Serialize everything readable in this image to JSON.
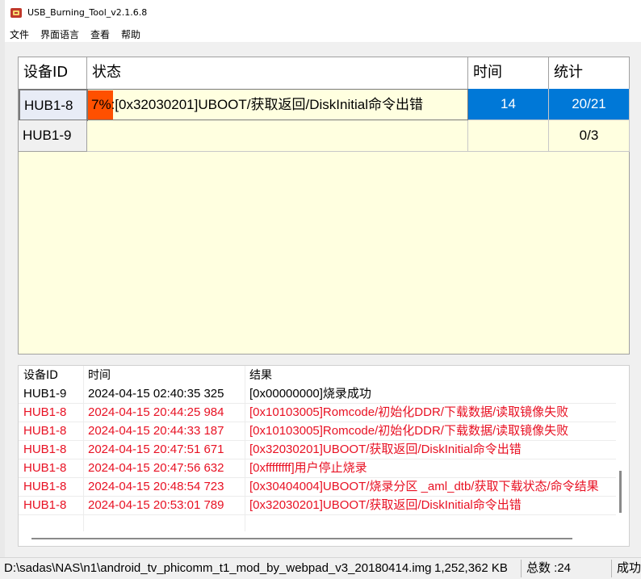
{
  "window": {
    "title": "USB_Burning_Tool_v2.1.6.8"
  },
  "menu": [
    "文件",
    "界面语言",
    "查看",
    "帮助"
  ],
  "device_grid": {
    "headers": [
      "设备ID",
      "状态",
      "时间",
      "统计"
    ],
    "rows": [
      {
        "id": "HUB1-8",
        "progress_percent": 7,
        "progress_label": "7%",
        "status_message": ":[0x32030201]UBOOT/获取返回/DiskInitial命令出错",
        "time": "14",
        "count": "20/21"
      },
      {
        "id": "HUB1-9",
        "progress_percent": null,
        "progress_label": "",
        "status_message": "",
        "time": "",
        "count": "0/3"
      }
    ]
  },
  "log": {
    "headers": [
      "设备ID",
      "时间",
      "结果"
    ],
    "rows": [
      {
        "id": "HUB1-9",
        "time": "2024-04-15 02:40:35 325",
        "result": "[0x00000000]烧录成功",
        "color": "#000000"
      },
      {
        "id": "HUB1-8",
        "time": "2024-04-15 20:44:25 984",
        "result": "[0x10103005]Romcode/初始化DDR/下载数据/读取镜像失败",
        "color": "#e81123"
      },
      {
        "id": "HUB1-8",
        "time": "2024-04-15 20:44:33 187",
        "result": "[0x10103005]Romcode/初始化DDR/下载数据/读取镜像失败",
        "color": "#e81123"
      },
      {
        "id": "HUB1-8",
        "time": "2024-04-15 20:47:51 671",
        "result": "[0x32030201]UBOOT/获取返回/DiskInitial命令出错",
        "color": "#e81123"
      },
      {
        "id": "HUB1-8",
        "time": "2024-04-15 20:47:56 632",
        "result": "[0xffffffff]用户停止烧录",
        "color": "#e81123"
      },
      {
        "id": "HUB1-8",
        "time": "2024-04-15 20:48:54 723",
        "result": "[0x30404004]UBOOT/烧录分区 _aml_dtb/获取下载状态/命令结果",
        "color": "#e81123"
      },
      {
        "id": "HUB1-8",
        "time": "2024-04-15 20:53:01 789",
        "result": "[0x32030201]UBOOT/获取返回/DiskInitial命令出错",
        "color": "#e81123"
      }
    ]
  },
  "statusbar": {
    "path": "D:\\sadas\\NAS\\n1\\android_tv_phicomm_t1_mod_by_webpad_v3_20180414.img",
    "size": "1,252,362 KB",
    "total": "总数 :24",
    "result": "成功"
  },
  "colors": {
    "accent_blue": "#0078d7",
    "progress_orange": "#ff5000",
    "grid_bg": "#ffffe0",
    "error_red": "#e81123"
  },
  "icons": {
    "app": "usb-burning-tool-icon"
  }
}
